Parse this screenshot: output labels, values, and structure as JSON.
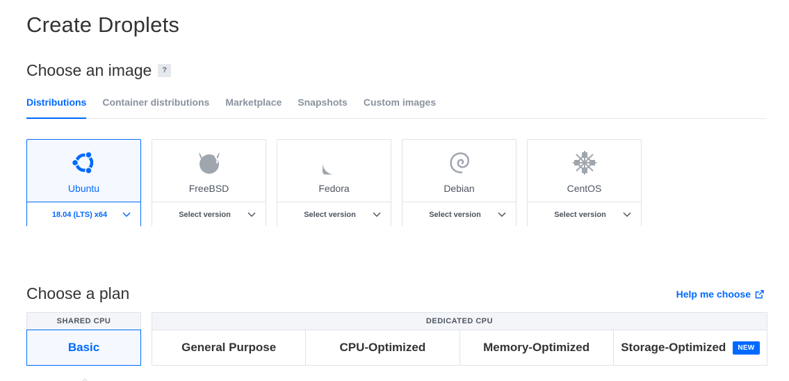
{
  "page": {
    "title": "Create Droplets"
  },
  "image_section": {
    "title": "Choose an image",
    "help_badge": "?",
    "tabs": [
      {
        "label": "Distributions",
        "active": true
      },
      {
        "label": "Container distributions",
        "active": false
      },
      {
        "label": "Marketplace",
        "active": false
      },
      {
        "label": "Snapshots",
        "active": false
      },
      {
        "label": "Custom images",
        "active": false
      }
    ],
    "distributions": [
      {
        "name": "Ubuntu",
        "version": "18.04 (LTS) x64",
        "selected": true,
        "icon": "ubuntu-icon"
      },
      {
        "name": "FreeBSD",
        "version": "Select version",
        "selected": false,
        "icon": "freebsd-icon"
      },
      {
        "name": "Fedora",
        "version": "Select version",
        "selected": false,
        "icon": "fedora-icon"
      },
      {
        "name": "Debian",
        "version": "Select version",
        "selected": false,
        "icon": "debian-icon"
      },
      {
        "name": "CentOS",
        "version": "Select version",
        "selected": false,
        "icon": "centos-icon"
      }
    ]
  },
  "plan_section": {
    "title": "Choose a plan",
    "help_link": "Help me choose",
    "shared_cpu": {
      "header": "SHARED CPU",
      "options": [
        {
          "label": "Basic",
          "selected": true
        }
      ]
    },
    "dedicated_cpu": {
      "header": "DEDICATED CPU",
      "options": [
        {
          "label": "General Purpose",
          "selected": false
        },
        {
          "label": "CPU-Optimized",
          "selected": false
        },
        {
          "label": "Memory-Optimized",
          "selected": false
        },
        {
          "label": "Storage-Optimized",
          "selected": false,
          "badge": "NEW"
        }
      ]
    }
  },
  "colors": {
    "accent": "#0069ff",
    "border": "#dfe3e8",
    "muted": "#8a929e",
    "icon_gray": "#a0a6ae"
  }
}
